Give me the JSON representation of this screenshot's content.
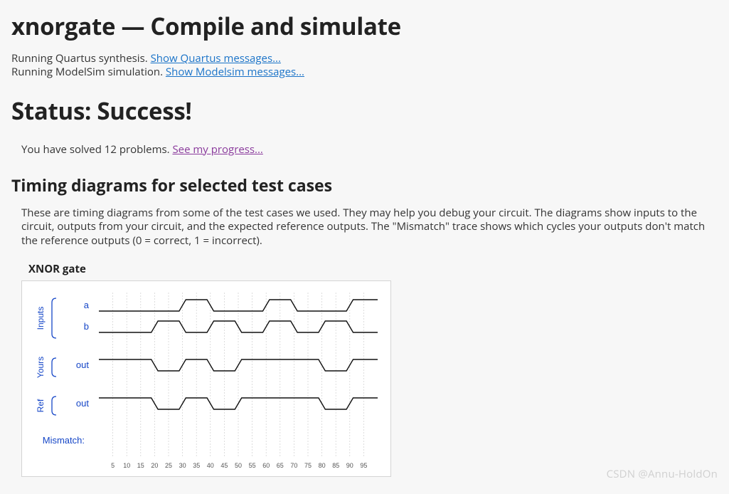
{
  "page": {
    "title": "xnorgate — Compile and simulate"
  },
  "synthesis": {
    "line1_prefix": "Running Quartus synthesis. ",
    "line1_link": "Show Quartus messages...",
    "line2_prefix": "Running ModelSim simulation. ",
    "line2_link": "Show Modelsim messages..."
  },
  "status": {
    "heading": "Status: Success!"
  },
  "progress": {
    "text": "You have solved 12 problems. ",
    "link": "See my progress..."
  },
  "timing": {
    "heading": "Timing diagrams for selected test cases",
    "description": "These are timing diagrams from some of the test cases we used. They may help you debug your circuit. The diagrams show inputs to the circuit, outputs from your circuit, and the expected reference outputs. The \"Mismatch\" trace shows which cycles your outputs don't match the reference outputs (0 = correct, 1 = incorrect)."
  },
  "diagram": {
    "title": "XNOR gate",
    "sections": {
      "inputs": "Inputs",
      "yours": "Yours",
      "ref": "Ref",
      "mismatch": "Mismatch:"
    },
    "signals": {
      "a": "a",
      "b": "b",
      "out_yours": "out",
      "out_ref": "out"
    },
    "ticks": [
      "5",
      "10",
      "15",
      "20",
      "25",
      "30",
      "35",
      "40",
      "45",
      "50",
      "55",
      "60",
      "65",
      "70",
      "75",
      "80",
      "85",
      "90",
      "95"
    ]
  },
  "chart_data": {
    "type": "timing-diagram",
    "time_range": [
      0,
      100
    ],
    "tick_interval": 5,
    "signals": [
      {
        "name": "a",
        "group": "Inputs",
        "initial": 0,
        "transitions": [
          [
            30,
            1
          ],
          [
            40,
            0
          ],
          [
            60,
            1
          ],
          [
            70,
            0
          ],
          [
            90,
            1
          ]
        ]
      },
      {
        "name": "b",
        "group": "Inputs",
        "initial": 0,
        "transitions": [
          [
            20,
            1
          ],
          [
            30,
            0
          ],
          [
            40,
            1
          ],
          [
            50,
            0
          ],
          [
            60,
            1
          ],
          [
            70,
            0
          ],
          [
            80,
            1
          ],
          [
            90,
            0
          ]
        ]
      },
      {
        "name": "out",
        "group": "Yours",
        "initial": 1,
        "transitions": [
          [
            20,
            0
          ],
          [
            30,
            1
          ],
          [
            40,
            0
          ],
          [
            50,
            1
          ],
          [
            80,
            0
          ],
          [
            90,
            1
          ]
        ]
      },
      {
        "name": "out",
        "group": "Ref",
        "initial": 1,
        "transitions": [
          [
            20,
            0
          ],
          [
            30,
            1
          ],
          [
            40,
            0
          ],
          [
            50,
            1
          ],
          [
            80,
            0
          ],
          [
            90,
            1
          ]
        ]
      },
      {
        "name": "mismatch",
        "group": "Mismatch",
        "initial": 0,
        "transitions": []
      }
    ]
  },
  "watermark": "CSDN @Annu-HoldOn"
}
